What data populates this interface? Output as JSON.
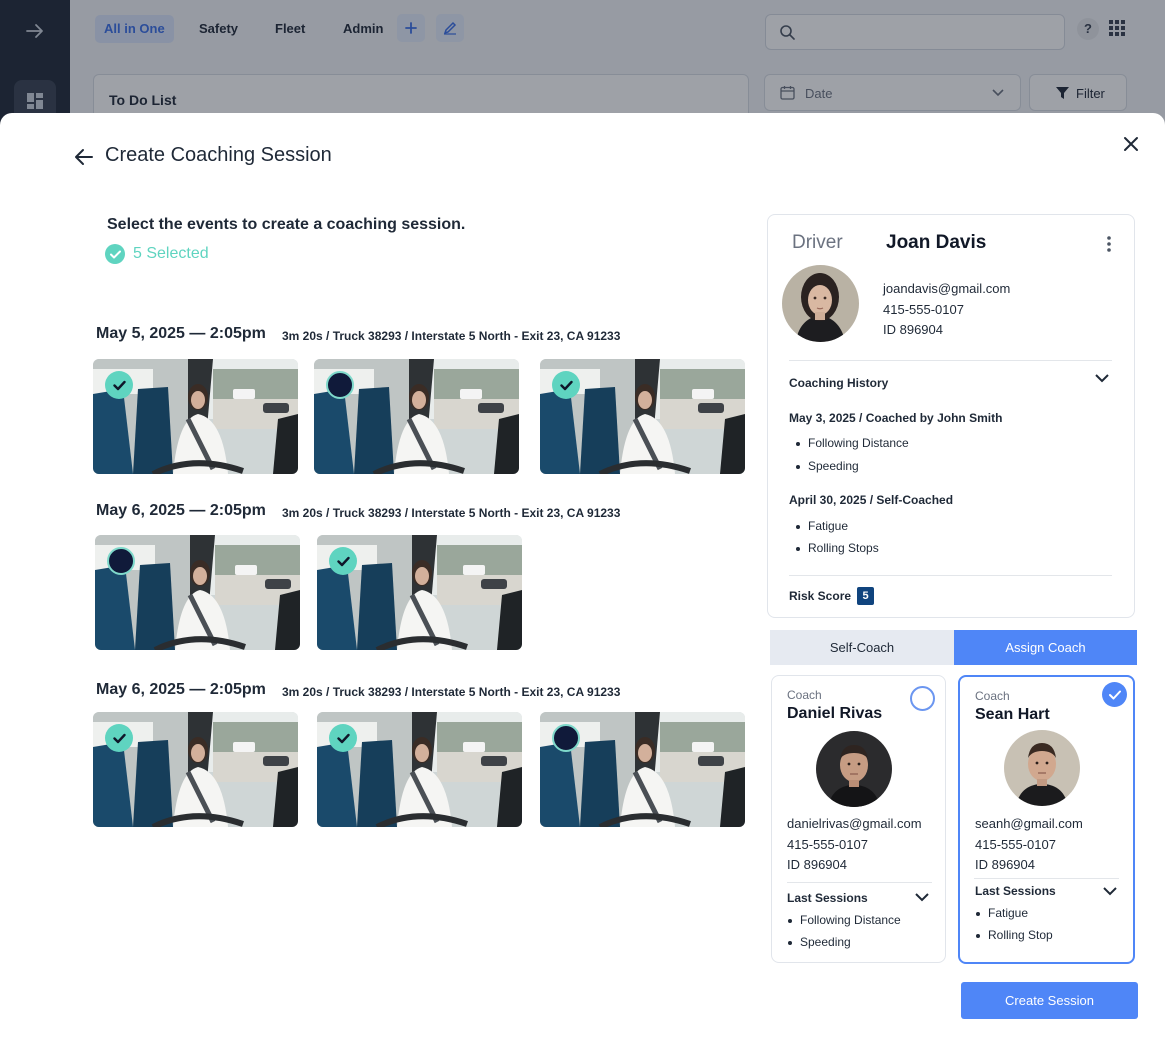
{
  "background": {
    "tabs": [
      "All in One",
      "Safety",
      "Fleet",
      "Admin"
    ],
    "todo_title": "To Do List",
    "date_placeholder": "Date",
    "filter_label": "Filter",
    "help_label": "?"
  },
  "modal": {
    "title": "Create Coaching Session",
    "instruction": "Select the events to create a coaching session.",
    "selected_text": "5 Selected"
  },
  "event_groups": [
    {
      "date": "May 5, 2025 — 2:05pm",
      "meta": "3m 20s  /  Truck 38293  /  Interstate 5 North - Exit 23, CA 91233",
      "selected": [
        true,
        false,
        true
      ]
    },
    {
      "date": "May 6, 2025 — 2:05pm",
      "meta": "3m 20s  /  Truck 38293  /  Interstate 5 North - Exit 23, CA 91233",
      "selected": [
        false,
        true
      ]
    },
    {
      "date": "May 6, 2025 — 2:05pm",
      "meta": "3m 20s  /  Truck 38293  /  Interstate 5 North - Exit 23, CA 91233",
      "selected": [
        true,
        true,
        false
      ]
    }
  ],
  "driver": {
    "label": "Driver",
    "name": "Joan Davis",
    "email": "joandavis@gmail.com",
    "phone": "415-555-0107",
    "id": "ID 896904",
    "coaching_history_title": "Coaching History",
    "history": [
      {
        "entry": "May 3, 2025 / Coached by John Smith",
        "items": [
          "Following Distance",
          "Speeding"
        ]
      },
      {
        "entry": "April 30, 2025 / Self-Coached",
        "items": [
          "Fatigue",
          "Rolling Stops"
        ]
      }
    ],
    "risk_label": "Risk Score",
    "risk_value": "5"
  },
  "coach_mode": {
    "self": "Self-Coach",
    "assign": "Assign Coach",
    "active": "assign"
  },
  "coaches": [
    {
      "role": "Coach",
      "name": "Daniel Rivas",
      "email": "danielrivas@gmail.com",
      "phone": "415-555-0107",
      "id": "ID 896904",
      "last_sessions_title": "Last Sessions",
      "sessions": [
        "Following Distance",
        "Speeding"
      ],
      "selected": false
    },
    {
      "role": "Coach",
      "name": "Sean Hart",
      "email": "seanh@gmail.com",
      "phone": "415-555-0107",
      "id": "ID 896904",
      "last_sessions_title": "Last Sessions",
      "sessions": [
        "Fatigue",
        "Rolling Stop"
      ],
      "selected": true
    }
  ],
  "create_button": "Create Session",
  "colors": {
    "accent": "#4f86f7",
    "teal": "#5fd4c0",
    "navy": "#10447e"
  }
}
